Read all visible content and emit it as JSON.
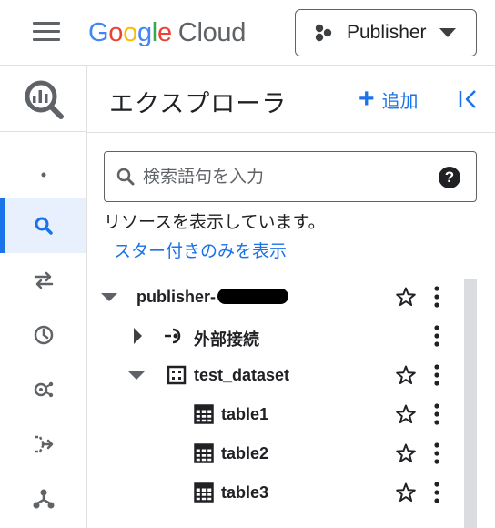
{
  "topbar": {
    "brand": {
      "google": [
        "G",
        "o",
        "o",
        "g",
        "l",
        "e"
      ],
      "product": "Cloud"
    },
    "project": {
      "name": "Publisher"
    }
  },
  "rail": {
    "items": [
      {
        "icon": "dot-icon"
      },
      {
        "icon": "search-icon",
        "active": true
      },
      {
        "icon": "transfer-icon"
      },
      {
        "icon": "history-icon"
      },
      {
        "icon": "analytics-hub-icon"
      },
      {
        "icon": "dataflow-icon"
      },
      {
        "icon": "graph-icon"
      }
    ]
  },
  "explorer": {
    "title": "エクスプローラ",
    "add_label": "追加",
    "search": {
      "placeholder": "検索語句を入力",
      "help": "?"
    },
    "info_text": "リソースを表示しています。",
    "starred_link": "スター付きのみを表示",
    "tree": [
      {
        "id": "project",
        "label": "publisher-",
        "redacted": true,
        "level": 0,
        "expanded": true,
        "icon": null,
        "star": true,
        "menu": true
      },
      {
        "id": "external",
        "label": "外部接続",
        "level": 1,
        "expanded": false,
        "icon": "external-connection-icon",
        "star": false,
        "menu": true
      },
      {
        "id": "dataset",
        "label": "test_dataset",
        "level": 1,
        "expanded": true,
        "icon": "dataset-icon",
        "star": true,
        "menu": true
      },
      {
        "id": "table1",
        "label": "table1",
        "level": 2,
        "icon": "table-icon",
        "star": true,
        "menu": true
      },
      {
        "id": "table2",
        "label": "table2",
        "level": 2,
        "icon": "table-icon",
        "star": true,
        "menu": true
      },
      {
        "id": "table3",
        "label": "table3",
        "level": 2,
        "icon": "table-icon",
        "star": true,
        "menu": true
      }
    ]
  },
  "colors": {
    "accent": "#1a73e8",
    "text": "#202124",
    "icon": "#5f6368"
  }
}
